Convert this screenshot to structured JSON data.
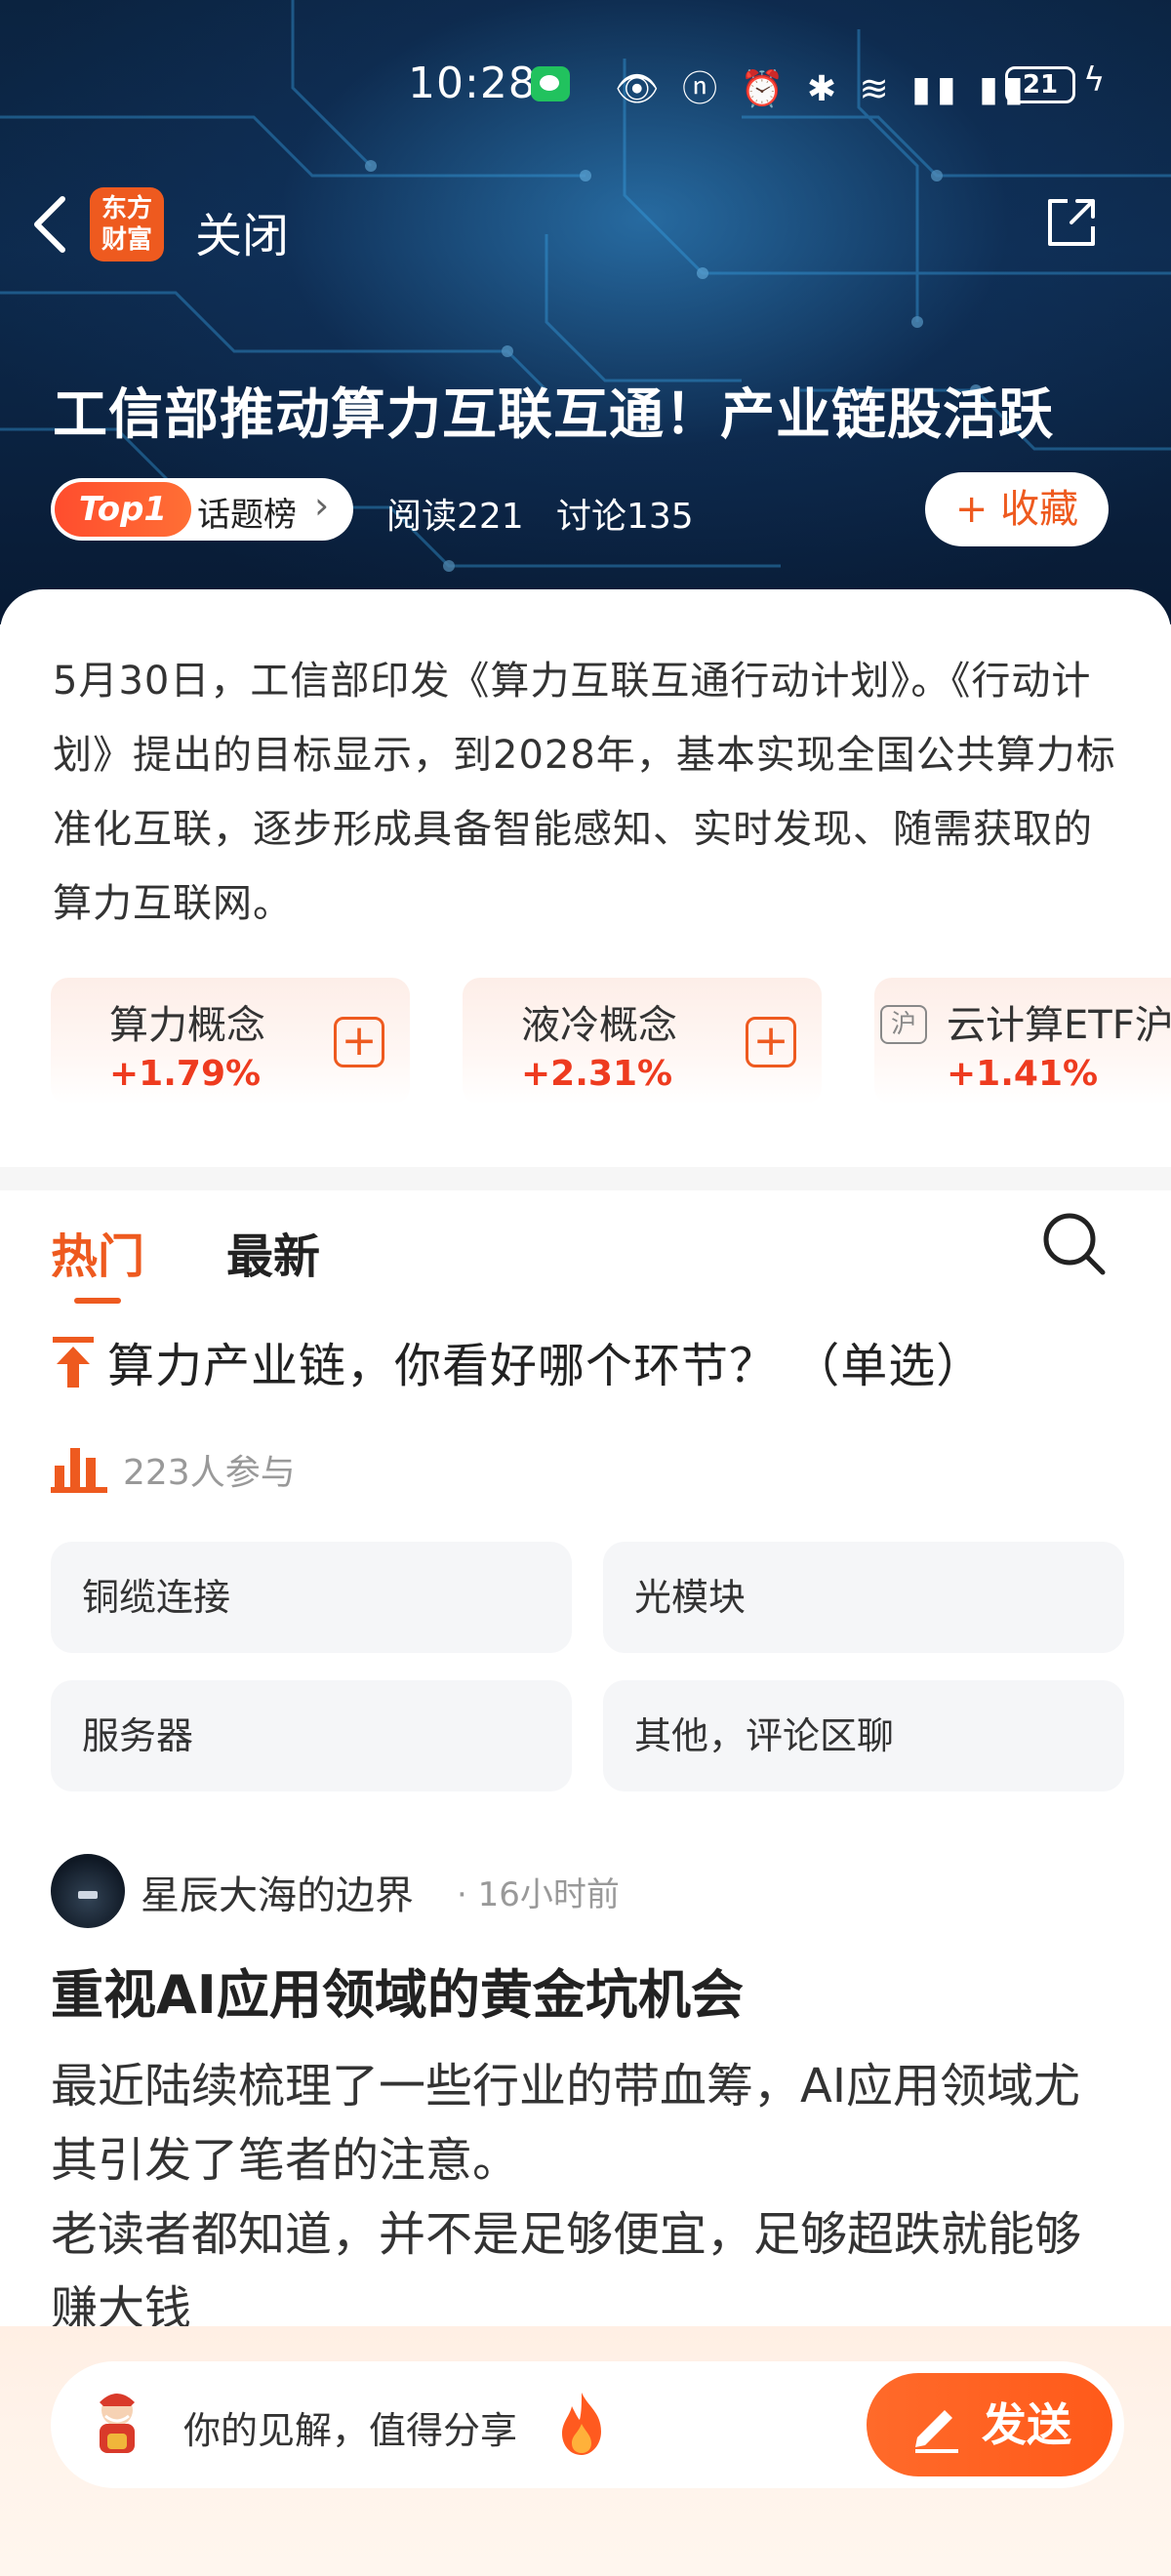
{
  "status_bar": {
    "time": "10:28",
    "battery": "21",
    "icons": [
      "wechat-icon",
      "eye-icon",
      "nfc-icon",
      "alarm-icon",
      "bluetooth-icon",
      "wifi-icon",
      "5g-signal-icon",
      "4g-signal-icon",
      "battery-icon",
      "charging-icon"
    ]
  },
  "nav": {
    "app_logo_line1": "东方",
    "app_logo_line2": "财富",
    "close_label": "关闭"
  },
  "topic": {
    "title": "工信部推动算力互联互通！产业链股活跃",
    "rank_badge": "Top1",
    "rank_label": "话题榜",
    "reads": "阅读221",
    "discussions": "讨论135",
    "collect_label": "+ 收藏"
  },
  "summary": {
    "text": "5月30日，工信部印发《算力互联互通行动计划》。《行动计划》提出的目标显示，到2028年，基本实现全国公共算力标准化互联，逐步形成具备智能感知、实时发现、随需获取的算力互联网。"
  },
  "concepts": [
    {
      "name": "算力概念",
      "change": "+1.79%"
    },
    {
      "name": "液冷概念",
      "change": "+2.31%"
    },
    {
      "name": "云计算ETF沪",
      "change": "+1.41%",
      "tag": "沪"
    }
  ],
  "tabs": {
    "hot": "热门",
    "latest": "最新"
  },
  "poll": {
    "question": "算力产业链，你看好哪个环节？ （单选）",
    "participants": "223人参与",
    "options": [
      "铜缆连接",
      "光模块",
      "服务器",
      "其他，评论区聊"
    ]
  },
  "post": {
    "author": "星辰大海的边界",
    "time": "· 16小时前",
    "title": "重视AI应用领域的黄金坑机会",
    "body_line1": "最近陆续梳理了一些行业的带血筹，AI应用领域尤其引发了笔者的注意。",
    "body_line2": "老读者都知道，并不是足够便宜，足够超跌就能够赚大钱"
  },
  "composer": {
    "placeholder": "你的见解，值得分享",
    "send_label": "发送"
  },
  "colors": {
    "accent": "#ee5a1f",
    "up": "#ee3b1f",
    "hero_bg": "#0b2340"
  }
}
